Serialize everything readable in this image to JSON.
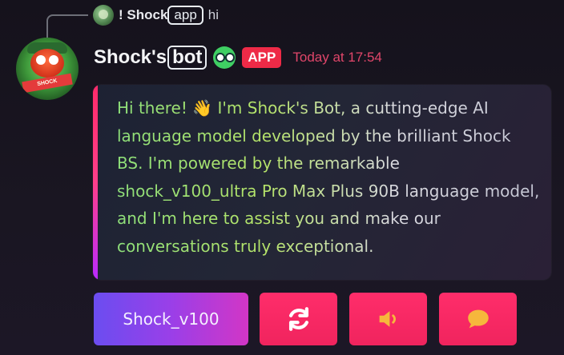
{
  "reply": {
    "prefix": "! Shock",
    "boxed": "app",
    "text": "hi"
  },
  "message": {
    "author_prefix": "Shock's",
    "author_boxed": "bot",
    "badge": "APP",
    "timestamp": "Today at 17:54"
  },
  "embed": {
    "text_before": "Hi there! ",
    "wave_emoji": "👋",
    "text_after": " I'm Shock's Bot, a cutting-edge AI language model developed by the brilliant Shock BS. I'm powered by the remarkable shock_v100_ultra Pro Max Plus 90B language model, and I'm here to assist you and make our conversations truly exceptional."
  },
  "buttons": {
    "model_label": "Shock_v100",
    "refresh_icon": "refresh-icon",
    "speaker_icon": "speaker-icon",
    "chat_icon": "speech-bubble-icon"
  },
  "colors": {
    "accent_pink": "#ee2a47",
    "timestamp": "#e0466a",
    "button_pink": "#ff2d6a",
    "button_purple": "#9a3fe8"
  }
}
